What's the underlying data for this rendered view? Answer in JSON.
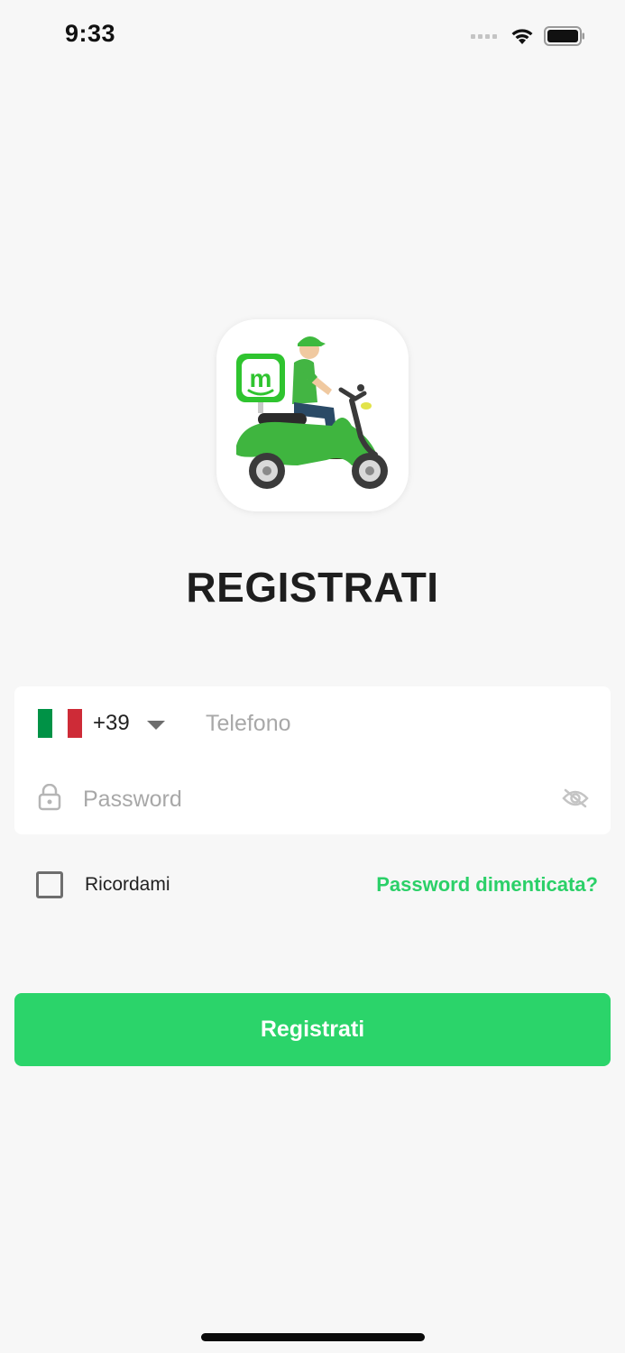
{
  "status_bar": {
    "time": "9:33",
    "icons": [
      "cellular-signal-icon",
      "wifi-icon",
      "battery-icon"
    ]
  },
  "logo": {
    "icon": "delivery-scooter-logo",
    "badge_letter": "m",
    "accent_color": "#3cc83c"
  },
  "title": "REGISTRATI",
  "form": {
    "country": {
      "flag_colors": [
        "#009246",
        "#ffffff",
        "#ce2b37"
      ],
      "code": "+39",
      "dropdown_icon": "caret-down-icon"
    },
    "phone": {
      "placeholder": "Telefono",
      "value": ""
    },
    "password": {
      "placeholder": "Password",
      "value": "",
      "leading_icon": "lock-icon",
      "toggle_icon": "eye-off-icon"
    }
  },
  "remember": {
    "label": "Ricordami",
    "checked": false
  },
  "forgot_password": "Password dimenticata?",
  "submit_label": "Registrati",
  "colors": {
    "primary": "#2bd46a",
    "link": "#2bd068",
    "background": "#f7f7f7"
  }
}
